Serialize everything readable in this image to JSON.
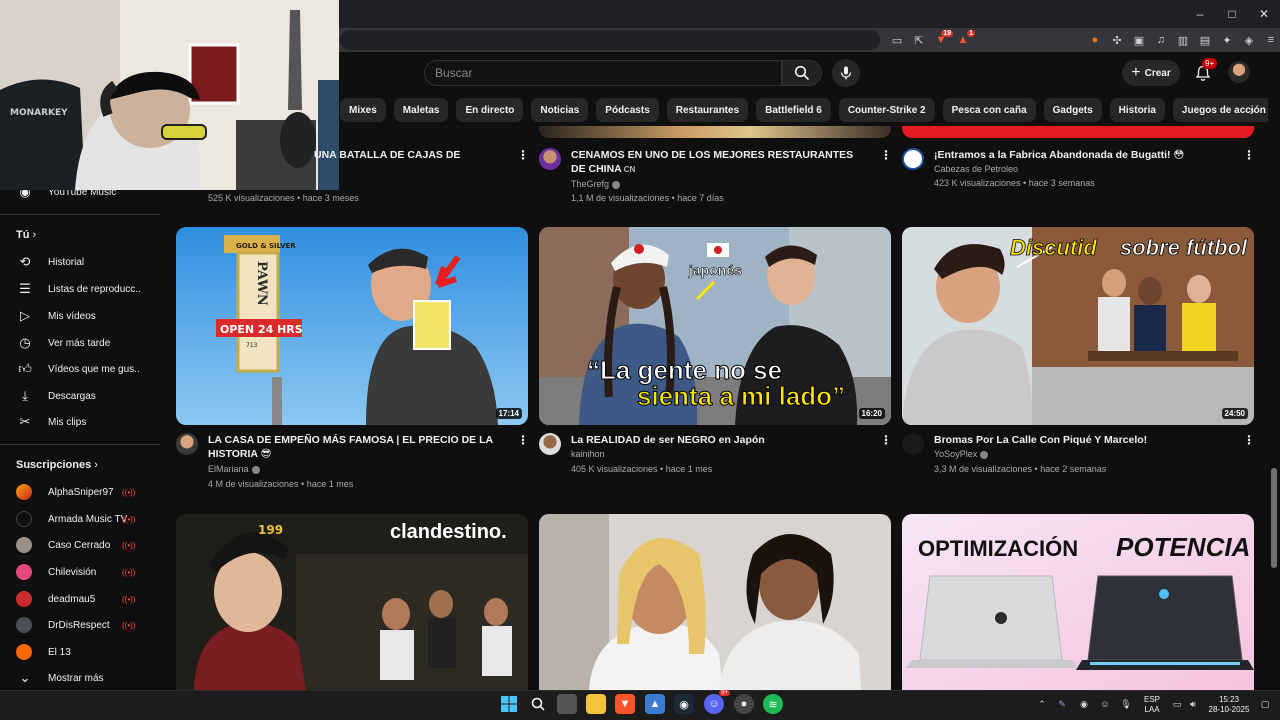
{
  "window": {
    "minimize": "–",
    "maximize": "□",
    "close": "✕"
  },
  "browser": {
    "brave_shield_count": "19",
    "rewards_count": "1"
  },
  "header": {
    "search_placeholder": "Buscar",
    "create_label": "Crear",
    "notifications_badge": "9+"
  },
  "chips": [
    "Mixes",
    "Maletas",
    "En directo",
    "Noticias",
    "Pódcasts",
    "Restaurantes",
    "Battlefield 6",
    "Counter-Strike 2",
    "Pesca con caña",
    "Gadgets",
    "Historia",
    "Juegos de acción y aventura"
  ],
  "sidebar": {
    "youtube_music": "YouTube Music",
    "you_heading": "Tú",
    "you_items": [
      "Historial",
      "Listas de reproducc...",
      "Mis vídeos",
      "Ver más tarde",
      "Vídeos que me gus...",
      "Descargas",
      "Mis clips"
    ],
    "subs_heading": "Suscripciones",
    "subscriptions": [
      "AlphaSniper97",
      "Armada Music TV",
      "Caso Cerrado",
      "Chilevisión",
      "deadmau5",
      "DrDisRespect",
      "El 13"
    ],
    "show_more": "Mostrar más",
    "live_glyph": "((•))"
  },
  "row0": [
    {
      "title": "UNA BATALLA DE CAJAS DE",
      "meta": "525 K visualizaciones • hace 3 meses"
    },
    {
      "title": "CENAMOS EN UNO DE LOS MEJORES RESTAURANTES DE CHINA",
      "title_flag": "CN",
      "channel": "TheGrefg",
      "meta": "1,1 M de visualizaciones • hace 7 días"
    },
    {
      "title": "¡Entramos a la Fabrica Abandonada de Bugatti! 😳",
      "channel": "Cabezas de Petroleo",
      "meta": "423 K visualizaciones • hace 3 semanas"
    }
  ],
  "row1": [
    {
      "title": "LA CASA DE EMPEÑO MÁS FAMOSA | EL PRECIO DE LA HISTORIA 😎",
      "channel": "ElMariana",
      "meta": "4 M de visualizaciones • hace 1 mes",
      "duration": "17:14",
      "thumb_text": {
        "sign_top": "GOLD & SILVER",
        "sign_main": "PAWN",
        "sign_open": "OPEN 24 HRS",
        "sign_num": "713"
      }
    },
    {
      "title": "La REALIDAD de ser NEGRO en Japón",
      "channel": "kainihon",
      "meta": "405 K visualizaciones • hace 1 mes",
      "duration": "16:20",
      "thumb_text": {
        "tag": "japonés",
        "line1": "“La gente no se",
        "line2": "sienta a mi lado”"
      }
    },
    {
      "title": "Bromas Por La Calle Con Piqué Y Marcelo!",
      "channel": "YoSoyPlex",
      "meta": "3,3 M de visualizaciones • hace 2 semanas",
      "duration": "24:50",
      "thumb_text": {
        "a": "Discutid",
        "b": "sobre fútbol"
      }
    }
  ],
  "row2": [
    {
      "thumb_text": {
        "main": "clandestino.",
        "cap": "199"
      }
    },
    {
      "thumb_text": {}
    },
    {
      "thumb_text": {
        "left": "OPTIMIZACIÓN",
        "right": "POTENCIA"
      }
    }
  ],
  "taskbar": {
    "lang_top": "ESP",
    "lang_bottom": "LAA",
    "time": "15:23",
    "date": "28-10-2025",
    "discord_badge": "9+"
  },
  "colors": {
    "yt_red": "#ff0000",
    "live_red": "#ff4e45",
    "accent_yellow": "#ffe600"
  }
}
